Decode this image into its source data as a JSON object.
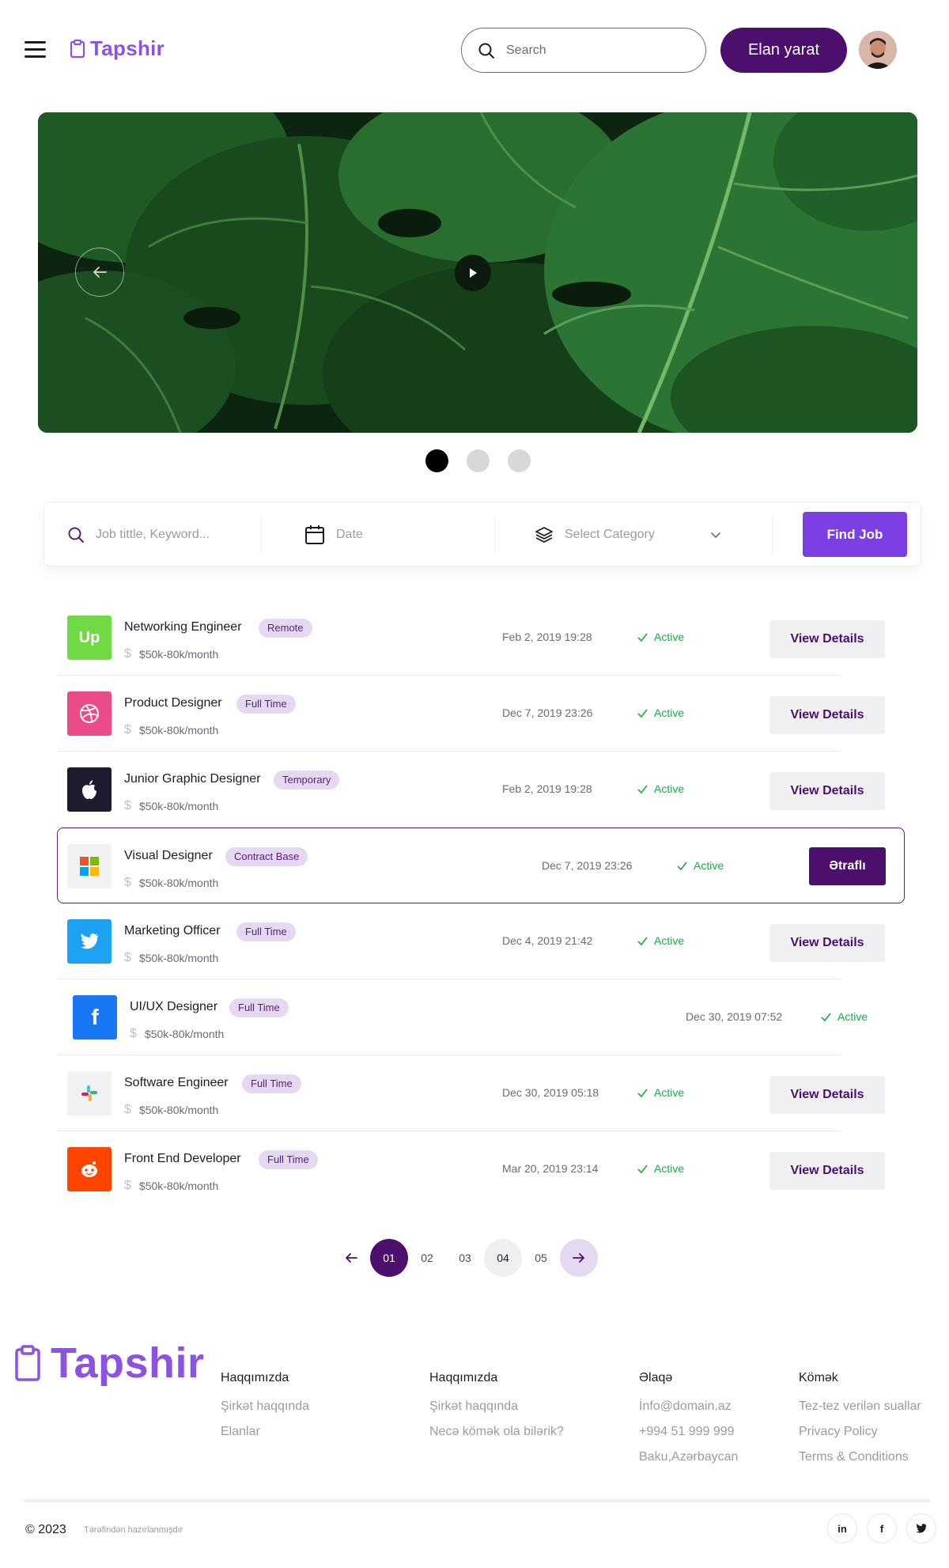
{
  "header": {
    "brand": "Tapshir",
    "search_placeholder": "Search",
    "cta_label": "Elan yarat"
  },
  "hero": {
    "slides_total": 3,
    "active_slide": 1
  },
  "filter": {
    "keyword_placeholder": "Job tittle, Keyword...",
    "date_label": "Date",
    "category_label": "Select Category",
    "submit_label": "Find Job"
  },
  "jobs": [
    {
      "title": "Networking Engineer",
      "type": "Remote",
      "salary": "$50k-80k/month",
      "date": "Feb 2, 2019 19:28",
      "status": "Active",
      "action": "View Details",
      "logo": "upwork-logo",
      "color": "#6fda44"
    },
    {
      "title": "Product Designer",
      "type": "Full Time",
      "salary": "$50k-80k/month",
      "date": "Dec 7, 2019 23:26",
      "status": "Active",
      "action": "View Details",
      "logo": "dribbble-logo",
      "color": "#ea4c89"
    },
    {
      "title": "Junior Graphic Designer",
      "type": "Temporary",
      "salary": "$50k-80k/month",
      "date": "Feb 2, 2019 19:28",
      "status": "Active",
      "action": "View Details",
      "logo": "apple-logo",
      "color": "#1c1c2e"
    },
    {
      "title": "Visual Designer",
      "type": "Contract Base",
      "salary": "$50k-80k/month",
      "date": "Dec 7, 2019 23:26",
      "status": "Active",
      "action": "Ətraflı",
      "logo": "microsoft-logo",
      "color": "#f2f2f5"
    },
    {
      "title": "Marketing Officer",
      "type": "Full Time",
      "salary": "$50k-80k/month",
      "date": "Dec 4, 2019 21:42",
      "status": "Active",
      "action": "View Details",
      "logo": "twitter-logo",
      "color": "#1da1f2"
    },
    {
      "title": "UI/UX Designer",
      "type": "Full Time",
      "salary": "$50k-80k/month",
      "date": "Dec 30, 2019 07:52",
      "status": "Active",
      "action": "",
      "logo": "facebook-logo",
      "color": "#1877f2"
    },
    {
      "title": "Software Engineer",
      "type": "Full Time",
      "salary": "$50k-80k/month",
      "date": "Dec 30, 2019 05:18",
      "status": "Active",
      "action": "View Details",
      "logo": "slack-logo",
      "color": "#f2f2f5"
    },
    {
      "title": "Front End Developer",
      "type": "Full Time",
      "salary": "$50k-80k/month",
      "date": "Mar 20, 2019 23:14",
      "status": "Active",
      "action": "View Details",
      "logo": "reddit-logo",
      "color": "#ff4500"
    }
  ],
  "pagination": {
    "pages": [
      "01",
      "02",
      "03",
      "04",
      "05"
    ],
    "current": "01"
  },
  "footer": {
    "brand": "Tapshir",
    "columns": [
      {
        "heading": "Haqqımızda",
        "links": [
          "Şirkət haqqında",
          "Elanlar"
        ]
      },
      {
        "heading": "Haqqımızda",
        "links": [
          "Şirkət haqqında",
          "Necə kömək ola bilərik?"
        ]
      },
      {
        "heading": "Əlaqə",
        "links": [
          "İnfo@domain.az",
          "+994 51 999 999",
          "Baku,Azərbaycan"
        ]
      },
      {
        "heading": "Kömək",
        "links": [
          "Tez-tez verilən suallar",
          "Privacy Policy",
          "Terms & Conditions"
        ]
      }
    ],
    "copyright": "© 2023",
    "made_by": "Tərəfindən hazırlanmışdır",
    "social": [
      "in",
      "f"
    ]
  }
}
